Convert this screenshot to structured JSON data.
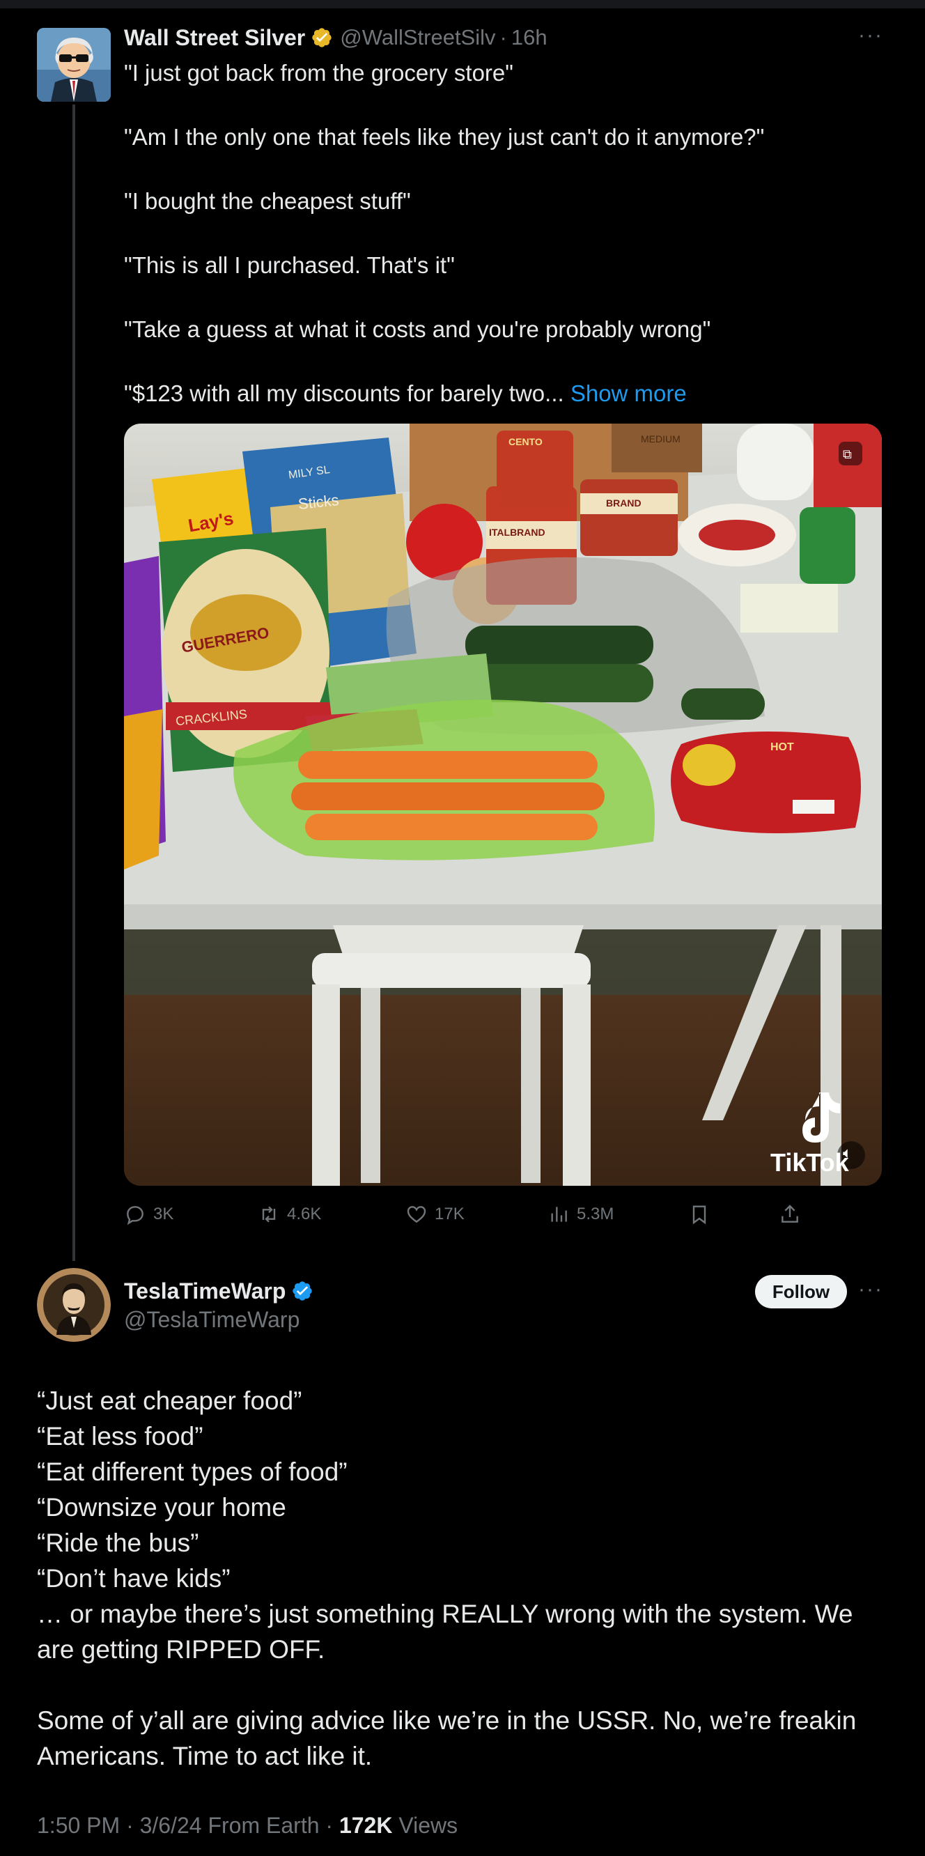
{
  "tweet": {
    "author": {
      "display_name": "Wall Street Silver",
      "handle": "@WallStreetSilv",
      "time": "16h",
      "verified_color": "#e8b829"
    },
    "text_lines": [
      "\"I just got back from the grocery store\"",
      "\"Am I the only one that feels like they just can't do it anymore?\"",
      "\"I bought the cheapest stuff\"",
      "\"This is all I purchased. That's it\"",
      "\"Take a guess at what it costs and you're probably wrong\"",
      "\"$123 with all my discounts for barely two..."
    ],
    "show_more": "Show more",
    "media": {
      "watermark": "TikTok",
      "product_labels": {
        "guerrero": "GUERRERO",
        "cracklins": "CRACKLINS",
        "sticks": "Sticks",
        "milk_sl": "MILY SL",
        "lays": "Lay's",
        "italbrand": "ITALBRAND",
        "brand": "BRAND",
        "centro": "CENTO",
        "medium": "MEDIUM",
        "hot": "HOT"
      }
    },
    "stats": {
      "replies": "3K",
      "reposts": "4.6K",
      "likes": "17K",
      "views": "5.3M"
    }
  },
  "reply": {
    "author": {
      "display_name": "TeslaTimeWarp",
      "handle": "@TeslaTimeWarp",
      "verified_color": "#1d9bf0"
    },
    "follow_label": "Follow",
    "lines": [
      "“Just eat cheaper food”",
      "“Eat less food”",
      "“Eat different types of food”",
      "“Downsize your home",
      "“Ride the bus”",
      "“Don’t have kids”",
      "… or maybe there’s just something REALLY wrong with the system. We",
      "are getting RIPPED OFF."
    ],
    "lines_2": [
      "Some of y’all are giving advice like we’re in the USSR. No, we’re freakin",
      "Americans. Time to act like it."
    ],
    "meta": {
      "time": "1:50 PM",
      "date": "3/6/24",
      "source": "From Earth",
      "views_count": "172K",
      "views_label": "Views"
    }
  },
  "icons": {
    "more": "more-horizontal-icon",
    "reply": "reply-icon",
    "repost": "repost-icon",
    "like": "heart-icon",
    "views": "views-chart-icon",
    "bookmark": "bookmark-icon",
    "share": "share-icon",
    "verified": "verified-badge-icon",
    "volume": "volume-icon",
    "gif": "caption-icon"
  }
}
